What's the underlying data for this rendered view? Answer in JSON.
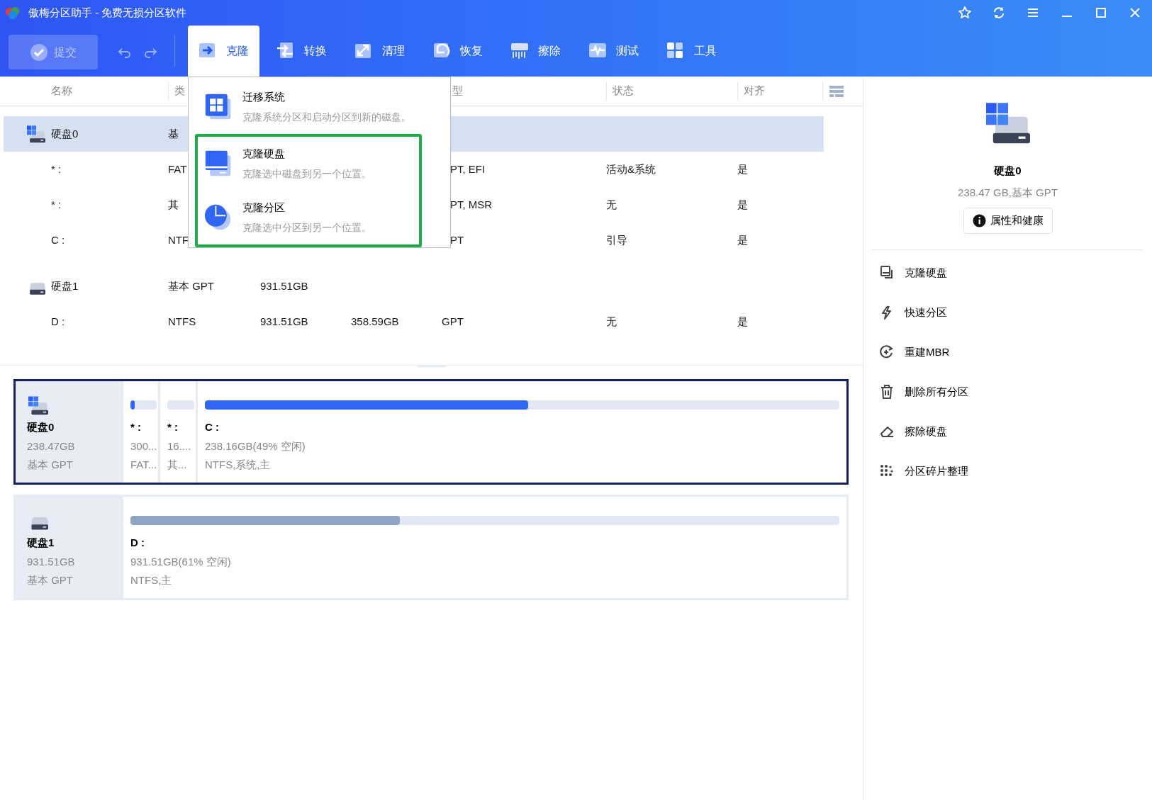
{
  "window": {
    "title": "傲梅分区助手 - 免费无损分区软件"
  },
  "toolbar": {
    "submit": {
      "label": "提交",
      "disabled": true
    },
    "tabs": [
      {
        "label": "克隆",
        "selected": true
      },
      {
        "label": "转换",
        "selected": false
      },
      {
        "label": "清理",
        "selected": false
      },
      {
        "label": "恢复",
        "selected": false
      },
      {
        "label": "擦除",
        "selected": false
      },
      {
        "label": "测试",
        "selected": false
      },
      {
        "label": "工具",
        "selected": false
      }
    ]
  },
  "clone_menu": {
    "items": [
      {
        "title": "迁移系统",
        "description": "克隆系统分区和启动分区到新的磁盘。",
        "highlighted": false
      },
      {
        "title": "克隆硬盘",
        "description": "克隆选中磁盘到另一个位置。",
        "highlighted": true
      },
      {
        "title": "克隆分区",
        "description": "克隆选中分区到另一个位置。",
        "highlighted": true
      }
    ]
  },
  "table": {
    "columns": [
      "名称",
      "类",
      null,
      null,
      "型",
      "状态",
      "对齐"
    ],
    "rows": [
      {
        "kind": "disk",
        "system": true,
        "selected": true,
        "cells": [
          "硬盘0",
          "基",
          null,
          null,
          null,
          null,
          null
        ]
      },
      {
        "kind": "partition",
        "selected": false,
        "cells": [
          "* :",
          "FAT",
          null,
          null,
          "PT, EFI",
          "活动&系统",
          "是"
        ]
      },
      {
        "kind": "partition",
        "selected": false,
        "cells": [
          "* :",
          "其",
          null,
          null,
          "PT, MSR",
          "无",
          "是"
        ]
      },
      {
        "kind": "partition",
        "selected": false,
        "cells": [
          "C :",
          "NTF",
          null,
          null,
          "PT",
          "引导",
          "是"
        ]
      },
      {
        "kind": "disk",
        "system": false,
        "selected": false,
        "cells": [
          "硬盘1",
          "基本 GPT",
          "931.51GB",
          null,
          null,
          null,
          null
        ]
      },
      {
        "kind": "partition",
        "selected": false,
        "cells": [
          "D :",
          "NTFS",
          "931.51GB",
          "358.59GB",
          "GPT",
          "无",
          "是"
        ]
      }
    ]
  },
  "disk_map": [
    {
      "name": "硬盘0",
      "size": "238.47GB",
      "type": "基本 GPT",
      "system": true,
      "selected": true,
      "partitions": [
        {
          "label": "* :",
          "size": "300...",
          "fs": "FAT...",
          "level": 0.15
        },
        {
          "label": "* :",
          "size": "16....",
          "fs": "其...",
          "level": 0
        },
        {
          "label": "C :",
          "size": "238.16GB(49% 空闲)",
          "fs": "NTFS,系统,主",
          "level": 0.51
        }
      ]
    },
    {
      "name": "硬盘1",
      "size": "931.51GB",
      "type": "基本 GPT",
      "system": false,
      "selected": false,
      "partitions": [
        {
          "label": "D :",
          "size": "931.51GB(61% 空闲)",
          "fs": "NTFS,主",
          "level": 0.38
        }
      ]
    }
  ],
  "side_panel": {
    "disk_name": "硬盘0",
    "info": "238.47 GB,基本 GPT",
    "button": "属性和健康",
    "actions": [
      "克隆硬盘",
      "快速分区",
      "重建MBR",
      "删除所有分区",
      "擦除硬盘",
      "分区碎片整理"
    ]
  }
}
